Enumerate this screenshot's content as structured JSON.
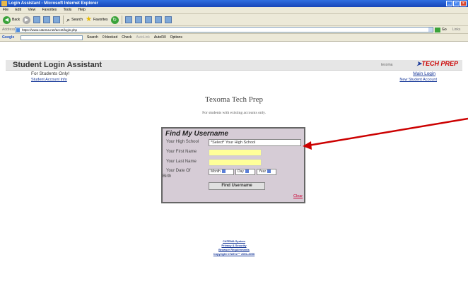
{
  "window": {
    "title": "Login Assistant - Microsoft Internet Explorer",
    "controls": [
      "_",
      "□",
      "×"
    ]
  },
  "menubar": [
    "File",
    "Edit",
    "View",
    "Favorites",
    "Tools",
    "Help"
  ],
  "toolbar": {
    "back": "Back",
    "search": "Search",
    "favorites": "Favorites"
  },
  "address": {
    "label": "Address",
    "url": "https://www.catema.net/accnt/login.php",
    "go": "Go",
    "links": "Links"
  },
  "googlebar": {
    "logo": "Google",
    "search": "Search",
    "blocked": "0 blocked",
    "check": "Check",
    "autolink": "AutoLink",
    "autofill": "AutoFill",
    "options": "Options"
  },
  "header": {
    "title": "Student Login Assistant",
    "school": "texoma",
    "logo": "TECH PREP"
  },
  "links": {
    "for_students": "For Students Only!",
    "account_info": "Student Account Info",
    "main_login": "Main Login",
    "new_account": "New Student Account"
  },
  "brand": "Texoma Tech Prep",
  "subnote": "For students with existing accounts only.",
  "form": {
    "title": "Find My Username",
    "high_school_label": "Your High School",
    "high_school_value": "*Select* Your High School",
    "first_name_label": "Your First Name",
    "first_name_value": "",
    "last_name_label": "Your Last Name",
    "last_name_value": "",
    "dob_label_1": "Your Date Of",
    "dob_label_2": "Birth",
    "month": "Month",
    "day": "Day",
    "year": "Year",
    "submit": "Find Username",
    "clear": "Clear"
  },
  "footer": {
    "line1": "CATEMA System",
    "line2": "Privacy & Security",
    "line3": "Browser Requirements",
    "line4": "Copyright CTATec™ 2001-2006"
  },
  "colors": {
    "accent": "#1a3a9a",
    "form_bg": "#d6ccd6",
    "input_yellow": "#ffff99",
    "arrow": "#cc0000"
  }
}
